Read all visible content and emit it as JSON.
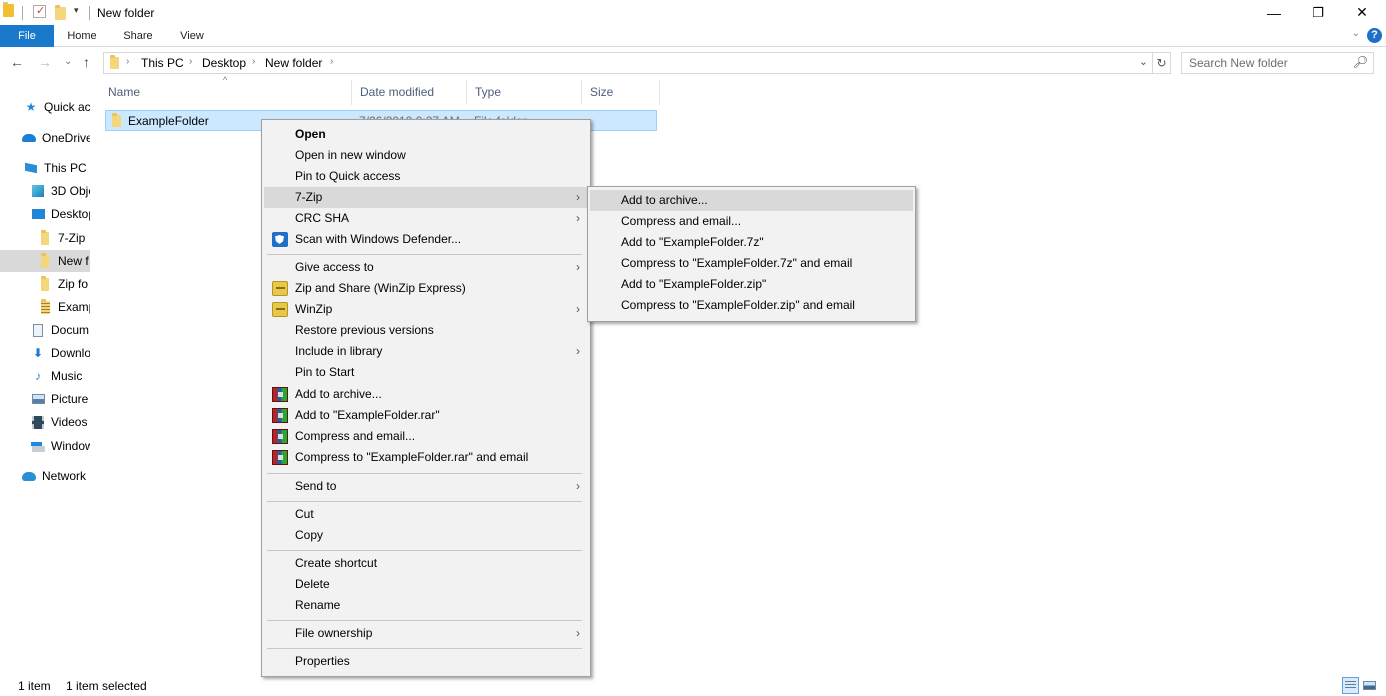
{
  "window": {
    "title": "New folder",
    "controls": {
      "minimize": "—",
      "maximize": "❐",
      "close": "✕"
    }
  },
  "ribbon": {
    "tabs": [
      {
        "label": "File"
      },
      {
        "label": "Home"
      },
      {
        "label": "Share"
      },
      {
        "label": "View"
      }
    ],
    "help": "?",
    "expand": "⌄"
  },
  "nav": {
    "back": "←",
    "forward": "→",
    "recent": "⌄",
    "up": "↑",
    "breadcrumb": [
      "This PC",
      "Desktop",
      "New folder"
    ],
    "separator": "›",
    "dropdown": "⌄",
    "refresh": "↻",
    "search_placeholder": "Search New folder",
    "search_icon": "⚲"
  },
  "sidebar": {
    "items": [
      {
        "label": "Quick ac",
        "icon": "star-icon"
      },
      {
        "label": "OneDrive",
        "icon": "cloud-icon"
      },
      {
        "label": "This PC",
        "icon": "computer-icon"
      },
      {
        "label": "3D Obje",
        "icon": "cube-icon"
      },
      {
        "label": "Desktop",
        "icon": "desktop-icon"
      },
      {
        "label": "7-Zip",
        "icon": "folder-icon"
      },
      {
        "label": "New f",
        "icon": "folder-icon",
        "selected": true
      },
      {
        "label": "Zip fo",
        "icon": "folder-icon"
      },
      {
        "label": "Examp",
        "icon": "zip-folder-icon"
      },
      {
        "label": "Docum",
        "icon": "documents-icon"
      },
      {
        "label": "Downlo",
        "icon": "download-icon"
      },
      {
        "label": "Music",
        "icon": "music-icon"
      },
      {
        "label": "Picture",
        "icon": "pictures-icon"
      },
      {
        "label": "Videos",
        "icon": "videos-icon"
      },
      {
        "label": "Window",
        "icon": "drive-icon"
      },
      {
        "label": "Network",
        "icon": "network-icon"
      }
    ]
  },
  "file_list": {
    "columns": [
      "Name",
      "Date modified",
      "Type",
      "Size"
    ],
    "rows": [
      {
        "name": "ExampleFolder",
        "date": "7/26/2019 9:27 AM",
        "type": "File folder",
        "size": "",
        "selected": true
      }
    ]
  },
  "context_menu": {
    "items": [
      {
        "label": "Open",
        "bold": true
      },
      {
        "label": "Open in new window"
      },
      {
        "label": "Pin to Quick access"
      },
      {
        "label": "7-Zip",
        "submenu": true,
        "hover": true
      },
      {
        "label": "CRC SHA",
        "submenu": true
      },
      {
        "label": "Scan with Windows Defender...",
        "icon": "defender-icon"
      },
      {
        "label": "Give access to",
        "submenu": true
      },
      {
        "label": "Zip and Share (WinZip Express)",
        "icon": "winzip-icon"
      },
      {
        "label": "WinZip",
        "icon": "winzip-icon",
        "submenu": true
      },
      {
        "label": "Restore previous versions"
      },
      {
        "label": "Include in library",
        "submenu": true
      },
      {
        "label": "Pin to Start"
      },
      {
        "label": "Add to archive...",
        "icon": "winrar-icon"
      },
      {
        "label": "Add to \"ExampleFolder.rar\"",
        "icon": "winrar-icon"
      },
      {
        "label": "Compress and email...",
        "icon": "winrar-icon"
      },
      {
        "label": "Compress to \"ExampleFolder.rar\" and email",
        "icon": "winrar-icon"
      },
      {
        "label": "Send to",
        "submenu": true
      },
      {
        "label": "Cut"
      },
      {
        "label": "Copy"
      },
      {
        "label": "Create shortcut"
      },
      {
        "label": "Delete"
      },
      {
        "label": "Rename"
      },
      {
        "label": "File ownership",
        "submenu": true
      },
      {
        "label": "Properties"
      }
    ],
    "submenu_arrow": "›"
  },
  "zip_submenu": {
    "items": [
      {
        "label": "Add to archive...",
        "hover": true
      },
      {
        "label": "Compress and email..."
      },
      {
        "label": "Add to \"ExampleFolder.7z\""
      },
      {
        "label": "Compress to \"ExampleFolder.7z\" and email"
      },
      {
        "label": "Add to \"ExampleFolder.zip\""
      },
      {
        "label": "Compress to \"ExampleFolder.zip\" and email"
      }
    ]
  },
  "status": {
    "count": "1 item",
    "selection": "1 item selected"
  },
  "colors": {
    "accent": "#1979ca",
    "selection_bg": "#cce8ff",
    "selection_border": "#99d1ff",
    "menu_bg": "#f2f2f2",
    "menu_hover": "#d9d9d9"
  }
}
